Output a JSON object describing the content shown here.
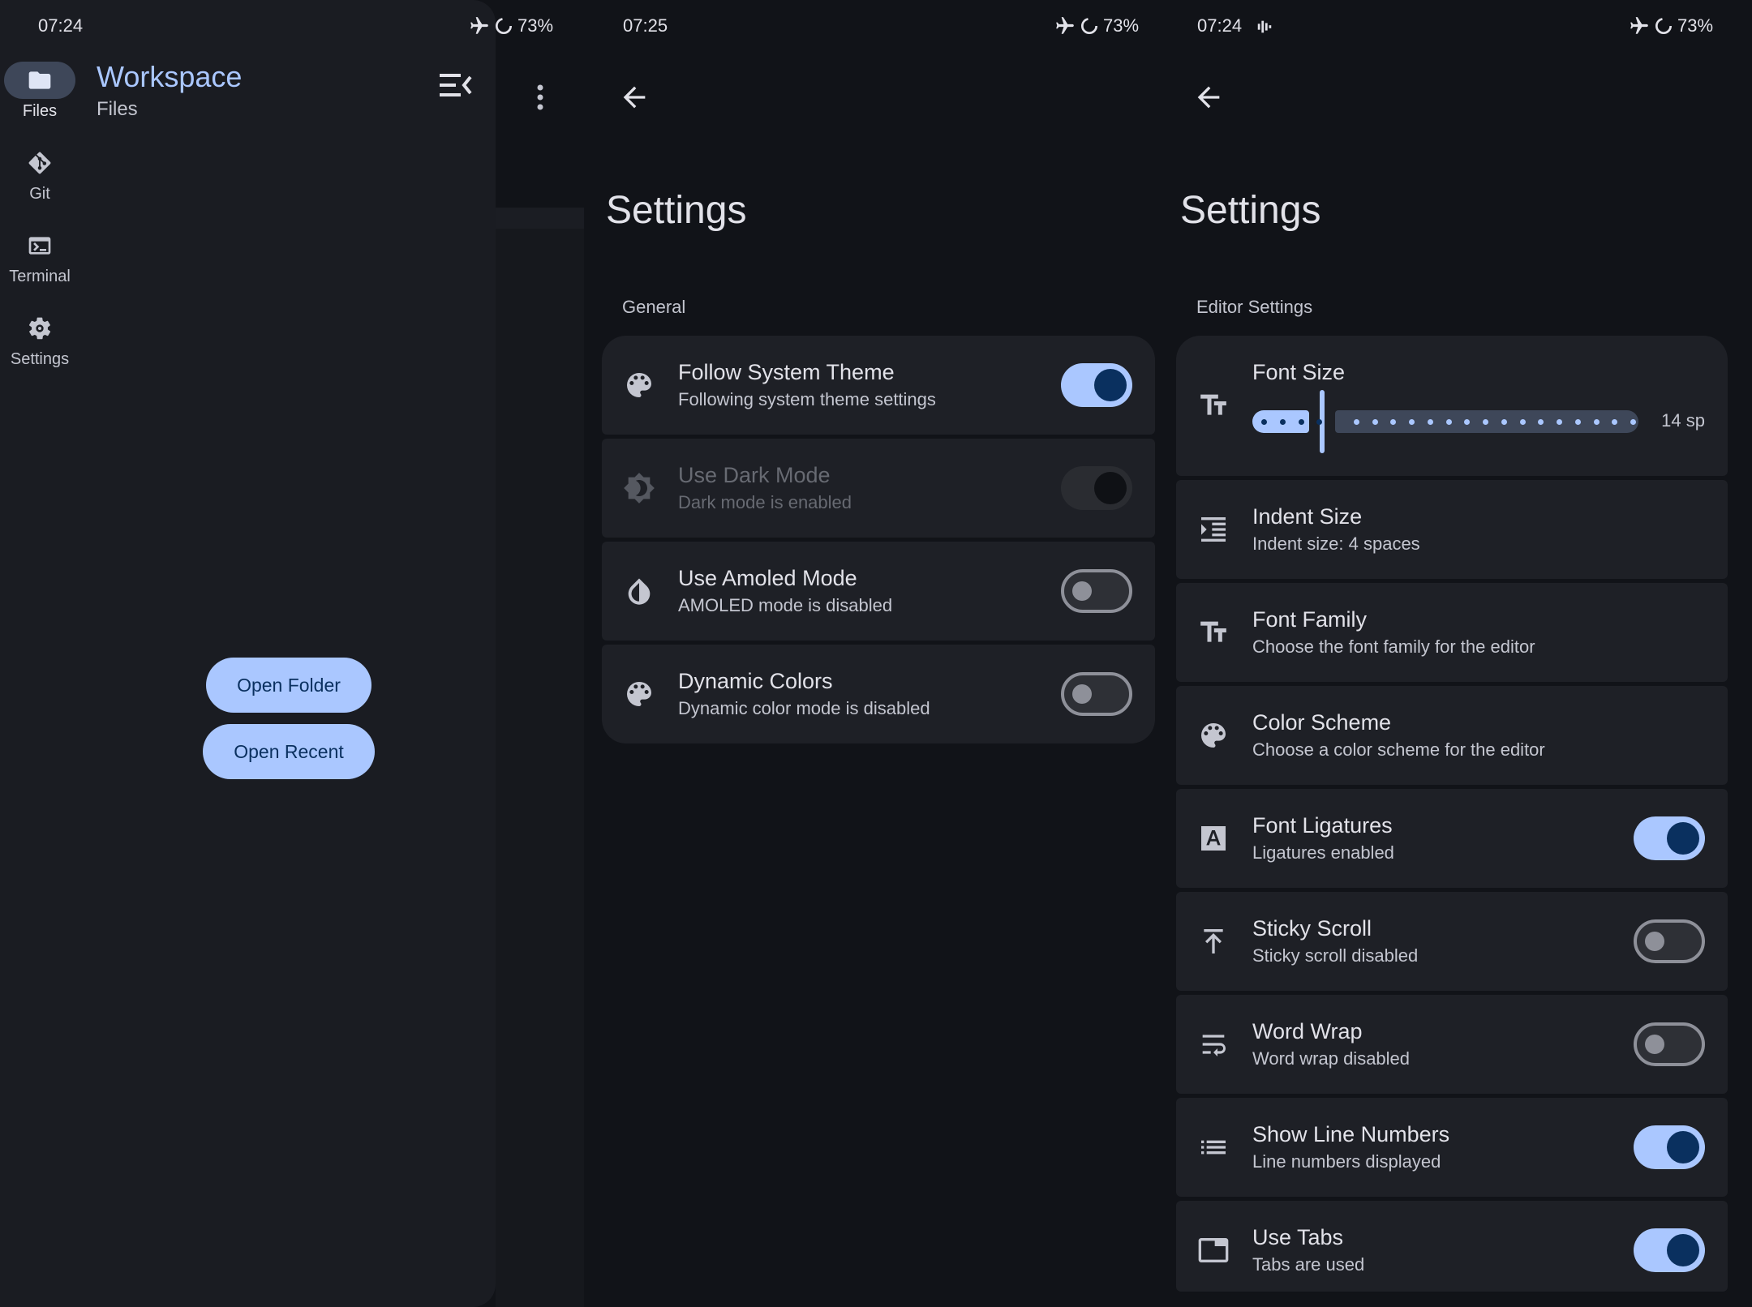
{
  "colors": {
    "background": "#111318",
    "surface": "#1e2026",
    "primary": "#aac7ff",
    "on_primary": "#0a305f"
  },
  "panel1": {
    "status": {
      "time": "07:24",
      "battery": "73%"
    },
    "rail": [
      {
        "label": "Files",
        "icon": "folder-icon",
        "active": true
      },
      {
        "label": "Git",
        "icon": "git-icon",
        "active": false
      },
      {
        "label": "Terminal",
        "icon": "terminal-icon",
        "active": false
      },
      {
        "label": "Settings",
        "icon": "gear-icon",
        "active": false
      }
    ],
    "title": "Workspace",
    "subtitle": "Files",
    "open_folder": "Open Folder",
    "open_recent": "Open Recent"
  },
  "panel2": {
    "status": {
      "time": "07:25",
      "battery": "73%"
    },
    "title": "Settings",
    "section": "General",
    "items": [
      {
        "title": "Follow System Theme",
        "subtitle": "Following system theme settings",
        "icon": "palette-icon",
        "toggle": "on"
      },
      {
        "title": "Use Dark Mode",
        "subtitle": "Dark mode is enabled",
        "icon": "contrast-icon",
        "toggle": "disabled-on"
      },
      {
        "title": "Use Amoled Mode",
        "subtitle": "AMOLED mode is disabled",
        "icon": "drop-half-icon",
        "toggle": "off"
      },
      {
        "title": "Dynamic Colors",
        "subtitle": "Dynamic color mode is disabled",
        "icon": "palette-icon",
        "toggle": "off"
      }
    ]
  },
  "panel3": {
    "status": {
      "time": "07:24",
      "battery": "73%"
    },
    "title": "Settings",
    "section": "Editor Settings",
    "font_size": {
      "title": "Font Size",
      "value_label": "14 sp",
      "value": 14,
      "min": 10,
      "max": 30,
      "steps": 20,
      "icon": "text-size-icon"
    },
    "items": [
      {
        "title": "Indent Size",
        "subtitle": "Indent size: 4 spaces",
        "icon": "indent-icon",
        "toggle": "none"
      },
      {
        "title": "Font Family",
        "subtitle": "Choose the font family for the editor",
        "icon": "text-size-icon",
        "toggle": "none"
      },
      {
        "title": "Color Scheme",
        "subtitle": "Choose a color scheme for the editor",
        "icon": "palette-icon",
        "toggle": "none"
      },
      {
        "title": "Font Ligatures",
        "subtitle": "Ligatures enabled",
        "icon": "letter-a-icon",
        "toggle": "on"
      },
      {
        "title": "Sticky Scroll",
        "subtitle": "Sticky scroll disabled",
        "icon": "pin-top-icon",
        "toggle": "off"
      },
      {
        "title": "Word Wrap",
        "subtitle": "Word wrap disabled",
        "icon": "wrap-text-icon",
        "toggle": "off"
      },
      {
        "title": "Show Line Numbers",
        "subtitle": "Line numbers displayed",
        "icon": "list-icon",
        "toggle": "on"
      },
      {
        "title": "Use Tabs",
        "subtitle": "Tabs are used",
        "icon": "tab-icon",
        "toggle": "on"
      }
    ]
  }
}
